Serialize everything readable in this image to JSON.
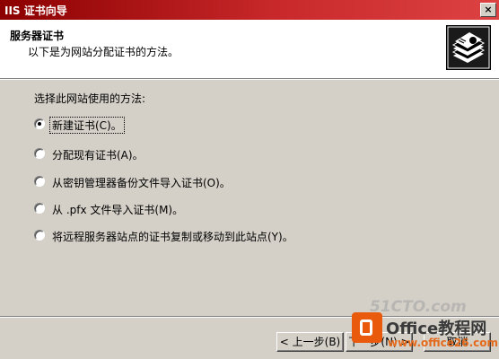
{
  "window": {
    "title": "IIS 证书向导",
    "close_label": "×"
  },
  "header": {
    "title": "服务器证书",
    "subtitle": "以下是为网站分配证书的方法。",
    "icon": "certificate-stack-icon"
  },
  "prompt": "选择此网站使用的方法:",
  "options": [
    {
      "label": "新建证书(C)。",
      "checked": true
    },
    {
      "label": "分配现有证书(A)。",
      "checked": false
    },
    {
      "label": "从密钥管理器备份文件导入证书(O)。",
      "checked": false
    },
    {
      "label": "从 .pfx 文件导入证书(M)。",
      "checked": false
    },
    {
      "label": "将远程服务器站点的证书复制或移动到此站点(Y)。",
      "checked": false
    }
  ],
  "buttons": {
    "back": "< 上一步(B)",
    "next": "下一步(N) >",
    "cancel": "取消"
  },
  "watermark": {
    "site_mark": "51CTO.com",
    "brand": "Office教程网",
    "url": "www.office26.com"
  },
  "colors": {
    "titlebar_start": "#8c0000",
    "titlebar_end": "#dd4242",
    "dialog_bg": "#d4d0c8",
    "watermark_orange": "#ea5a0c"
  }
}
